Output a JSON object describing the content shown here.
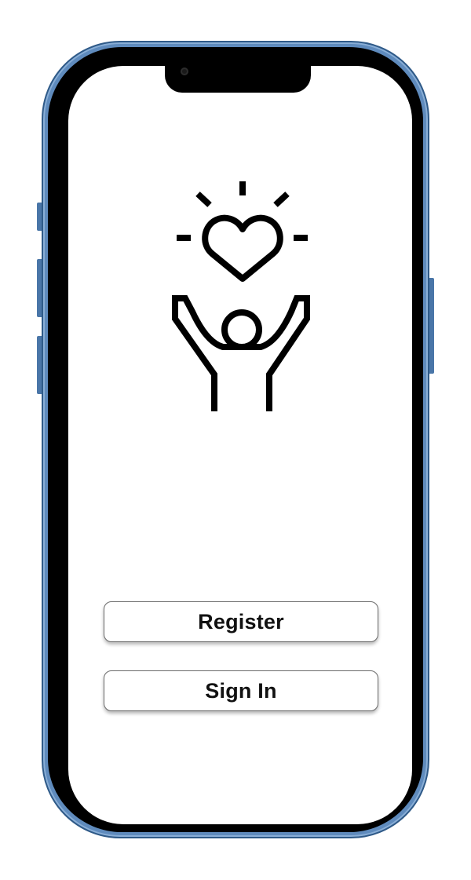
{
  "device": {
    "frame_color": "#5f8bbd",
    "bezel_color": "#000000",
    "screen_color": "#ffffff"
  },
  "hero": {
    "icon": "person-raising-arms-with-heart-icon",
    "stroke_color": "#000000"
  },
  "actions": {
    "register_label": "Register",
    "signin_label": "Sign In"
  }
}
